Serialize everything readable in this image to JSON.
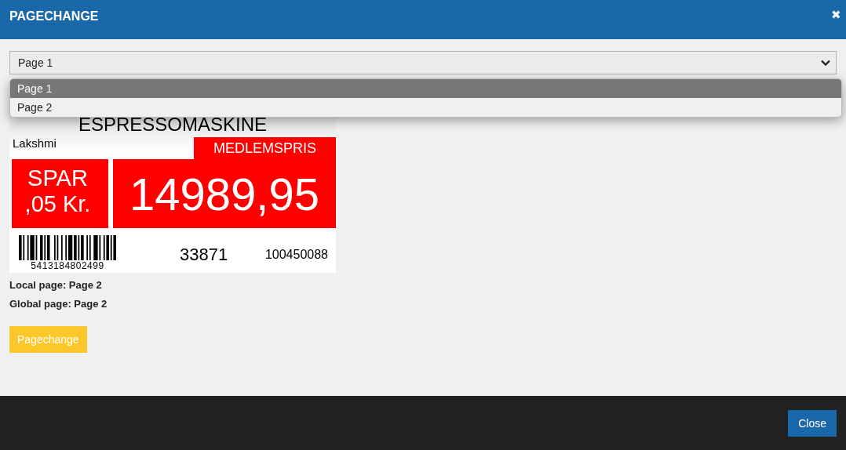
{
  "window": {
    "title": "PAGECHANGE",
    "close_icon": "✖"
  },
  "page_select": {
    "value": "Page 1",
    "expanded": true,
    "options": [
      {
        "label": "Page 1",
        "selected": true
      },
      {
        "label": "Page 2",
        "selected": false
      }
    ]
  },
  "label": {
    "title": "ESPRESSOMASKINE",
    "brand": "Lakshmi",
    "tag": "MEDLEMSPRIS",
    "saving_line_1": "SPAR",
    "saving_line_2": ",05 Kr.",
    "price": "14989,95",
    "barcode_number": "5413184802499",
    "code": "33871",
    "item_number": "100450088"
  },
  "info": [
    {
      "text": "Local page: Page 2"
    },
    {
      "text": "Global page: Page 2"
    }
  ],
  "pagechange_button": "Pagechange",
  "footer": {
    "close_button": "Close"
  }
}
